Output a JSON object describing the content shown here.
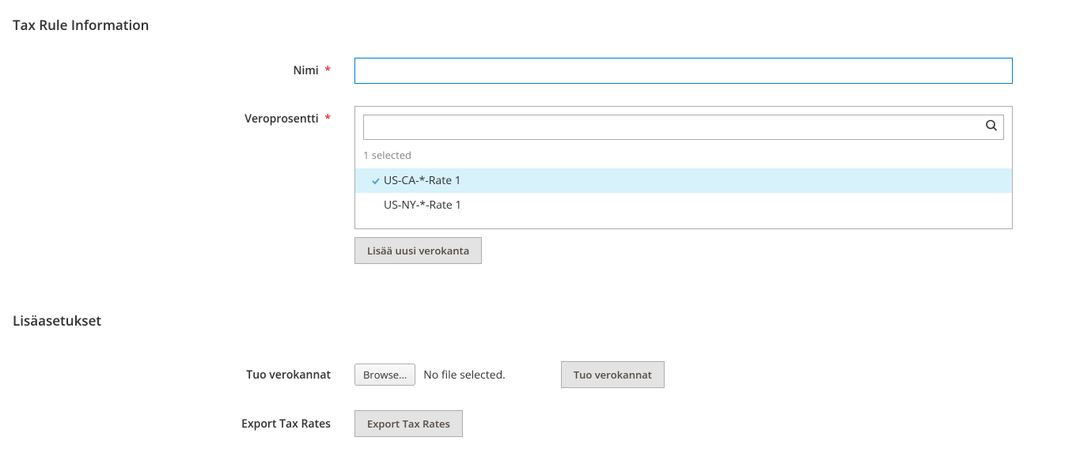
{
  "section1": {
    "title": "Tax Rule Information"
  },
  "name_field": {
    "label": "Nimi",
    "value": ""
  },
  "tax_rate": {
    "label": "Veroprosentti",
    "selected_text": "1 selected",
    "options": [
      {
        "label": "US-CA-*-Rate 1",
        "selected": true
      },
      {
        "label": "US-NY-*-Rate 1",
        "selected": false
      }
    ],
    "add_button": "Lisää uusi verokanta"
  },
  "section2": {
    "title": "Lisäasetukset"
  },
  "import": {
    "label": "Tuo verokannat",
    "browse": "Browse…",
    "no_file": "No file selected.",
    "button": "Tuo verokannat"
  },
  "export": {
    "label": "Export Tax Rates",
    "button": "Export Tax Rates"
  }
}
